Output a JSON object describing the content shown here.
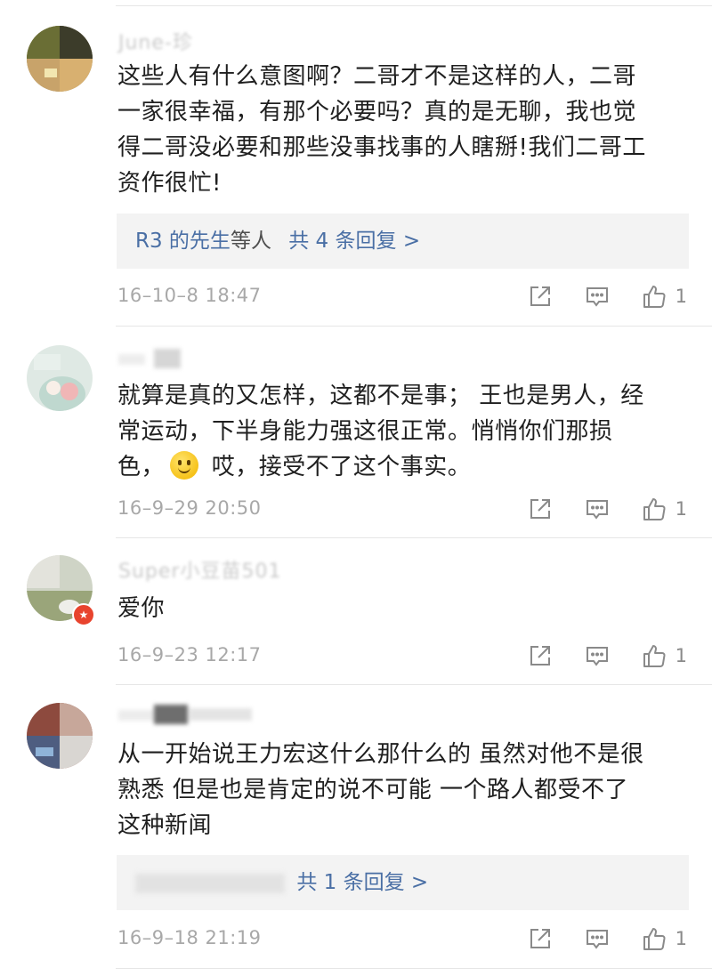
{
  "comments": [
    {
      "username": "June-珍",
      "text": "这些人有什么意图啊？二哥才不是这样的人，二哥一家很幸福，有那个必要吗？真的是无聊，我也觉得二哥没必要和那些没事找事的人瞎掰!我们二哥工资作很忙!",
      "lines": [
        "这些人有什么意图啊？二哥才不是这样的人，二哥",
        "一家很幸福，有那个必要吗？真的是无聊，我也觉",
        "得二哥没必要和那些没事找事的人瞎掰!我们二哥工",
        "资作很忙!"
      ],
      "reply_link_name": "R3 的先生",
      "reply_suffix": "等人",
      "reply_count_text": "共 4 条回复 >",
      "timestamp": "16–10–8 18:47",
      "likes": "1"
    },
    {
      "username": "",
      "lines": [
        "就算是真的又怎样，这都不是事； 王也是男人，经",
        "常运动，下半身能力强这很正常。悄悄你们那损",
        "色，",
        " 哎，接受不了这个事实。"
      ],
      "emoji": "smile-emoji",
      "timestamp": "16–9–29 20:50",
      "likes": "1"
    },
    {
      "username": "Super小豆苗501",
      "lines": [
        "爱你"
      ],
      "timestamp": "16–9–23 12:17",
      "likes": "1"
    },
    {
      "username": "",
      "lines": [
        "从一开始说王力宏这什么那什么的 虽然对他不是很",
        "熟悉 但是也是肯定的说不可能 一个路人都受不了",
        "这种新闻"
      ],
      "reply_count_text": "共 1 条回复 >",
      "timestamp": "16–9–18 21:19",
      "likes": "1"
    }
  ],
  "icons": {
    "share": "share-icon",
    "comment": "comment-icon",
    "like": "thumbs-up-icon"
  },
  "colors": {
    "link": "#4a6fa5",
    "meta": "#a8a8a8",
    "reply_bg": "#f3f3f3"
  }
}
